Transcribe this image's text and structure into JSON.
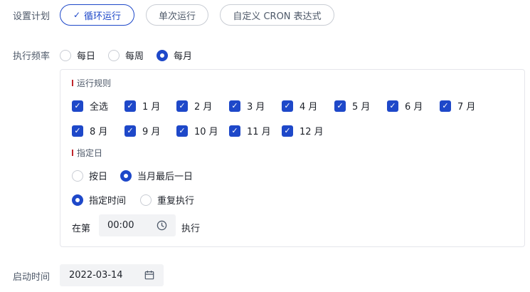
{
  "schedule": {
    "label": "设置计划",
    "options": [
      "循环运行",
      "单次运行",
      "自定义 CRON 表达式"
    ],
    "selected_index": 0
  },
  "frequency": {
    "label": "执行频率",
    "options": [
      "每日",
      "每周",
      "每月"
    ],
    "selected": "每月"
  },
  "rules": {
    "title": "运行规则",
    "select_all": "全选",
    "months": [
      "1 月",
      "2 月",
      "3 月",
      "4 月",
      "5 月",
      "6 月",
      "7 月",
      "8 月",
      "9 月",
      "10 月",
      "11 月",
      "12 月"
    ],
    "all_checked": true
  },
  "day": {
    "title": "指定日",
    "options": [
      "按日",
      "当月最后一日"
    ],
    "selected": "当月最后一日"
  },
  "time_mode": {
    "options": [
      "指定时间",
      "重复执行"
    ],
    "selected": "指定时间"
  },
  "time": {
    "prefix": "在第",
    "value": "00:00",
    "suffix": "执行"
  },
  "start": {
    "label": "启动时间",
    "value": "2022-03-14"
  },
  "colors": {
    "accent": "#1e48c9",
    "marker": "#c0272d"
  },
  "icons": {
    "time": "clock-icon",
    "date": "calendar-icon"
  }
}
